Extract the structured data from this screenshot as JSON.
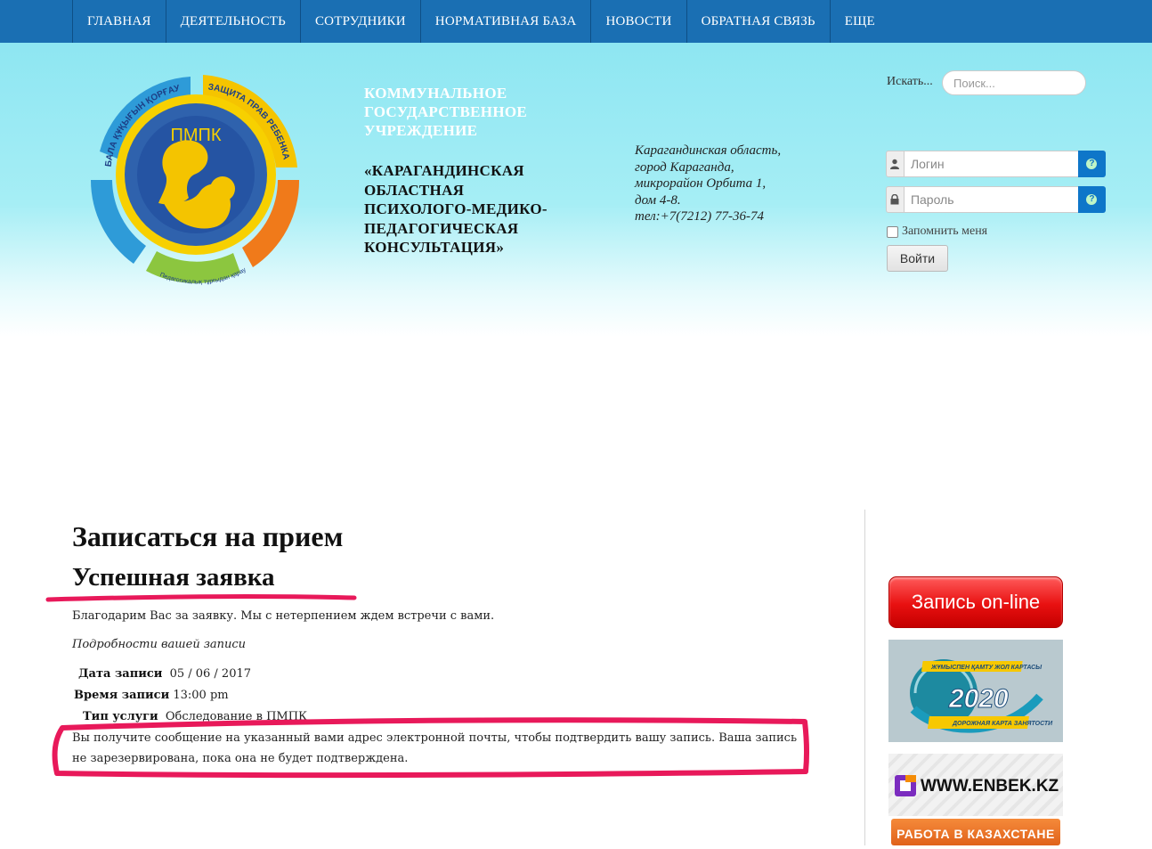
{
  "nav": {
    "items": [
      {
        "label": "ГЛАВНАЯ"
      },
      {
        "label": "ДЕЯТЕЛЬНОСТЬ"
      },
      {
        "label": "СОТРУДНИКИ"
      },
      {
        "label": "НОРМАТИВНАЯ БАЗА"
      },
      {
        "label": "НОВОСТИ"
      },
      {
        "label": "ОБРАТНАЯ СВЯЗЬ"
      },
      {
        "label": "ЕЩЕ"
      }
    ]
  },
  "header": {
    "logo": {
      "abbr": "ПМПК",
      "ring_top_left": "БАЛА ҚҰҚЫҒЫН ҚОРҒАУ",
      "ring_top_right": "ЗАЩИТА ПРАВ РЕБЕНКА",
      "ring_bottom": "Педагогикалық тұрғыдан қарау"
    },
    "org_type": "КОММУНАЛЬНОЕ ГОСУДАРСТВЕННОЕ УЧРЕЖДЕНИЕ",
    "org_name": "«КАРАГАНДИНСКАЯ ОБЛАСТНАЯ ПСИХОЛОГО-МЕДИКО-ПЕДАГОГИЧЕСКАЯ КОНСУЛЬТАЦИЯ»",
    "address_lines": [
      "Карагандинская область,",
      "город Караганда,",
      "микрорайон Орбита 1,",
      "дом 4-8.",
      "тел:+7(7212) 77-36-74"
    ]
  },
  "search": {
    "label": "Искать...",
    "placeholder": "Поиск..."
  },
  "login": {
    "username_placeholder": "Логин",
    "password_placeholder": "Пароль",
    "help": "?",
    "remember_label": "Запомнить меня",
    "submit_label": "Войти"
  },
  "content": {
    "title": "Записаться на прием",
    "subtitle": "Успешная заявка",
    "thanks": "Благодарим Вас за заявку. Мы с нетерпением ждем встречи с вами.",
    "details_heading": "Подробности вашей записи",
    "details": [
      {
        "label": "Дата записи",
        "value": "05 / 06 / 2017"
      },
      {
        "label": "Время записи",
        "value": "13:00 pm"
      },
      {
        "label": "Тип услуги",
        "value": "Обследование в ПМПК"
      }
    ],
    "note": "Вы получите сообщение на указанный вами адрес электронной почты, чтобы подтвердить вашу запись. Ваша запись не зарезервирована, пока она не будет подтверждена."
  },
  "sidebar": {
    "online_label": "Запись on-line",
    "banner_2020_top": "ЖҰМЫСПЕН ҚАМТУ ЖОЛ КАРТАСЫ",
    "banner_2020_year": "2020",
    "banner_2020_bottom": "ДОРОЖНАЯ КАРТА ЗАНЯТОСТИ",
    "enbek_label": "WWW.ENBEK.KZ",
    "rabota_label": "РАБОТА В КАЗАХСТАНЕ"
  },
  "colors": {
    "nav": "#1a6fb3",
    "annotation": "#e8195a",
    "accent_blue": "#0e76c9"
  }
}
